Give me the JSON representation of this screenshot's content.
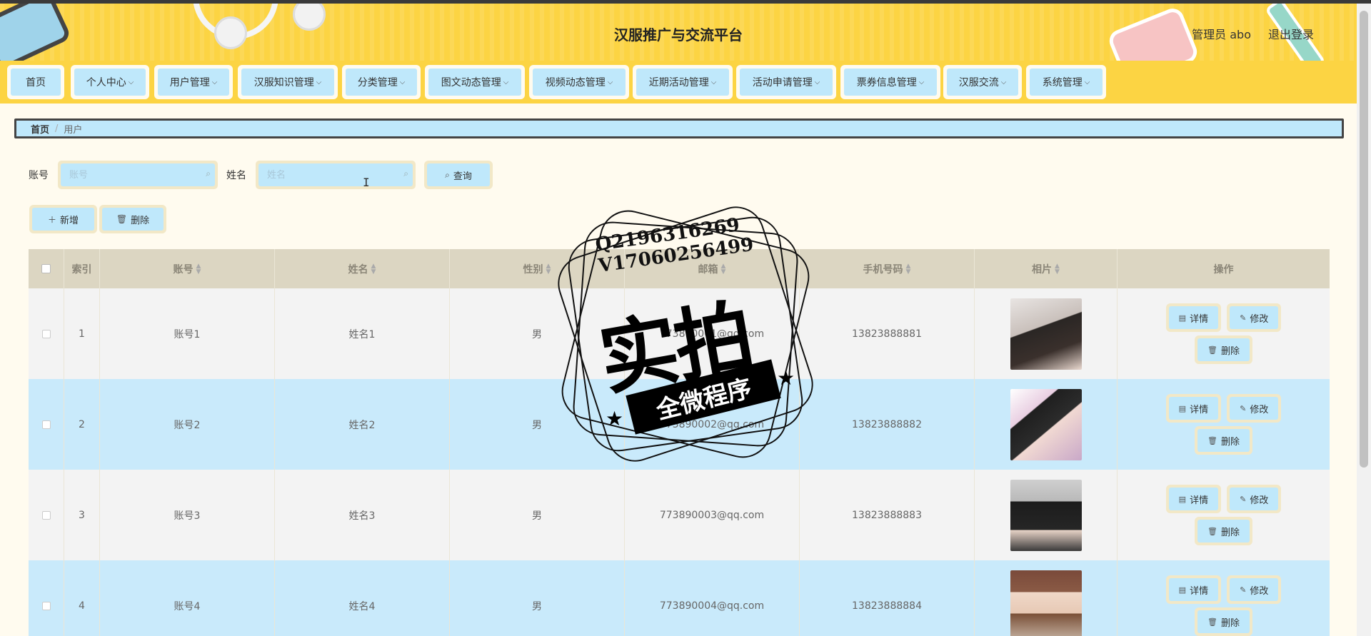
{
  "header": {
    "title": "汉服推广与交流平台",
    "user": "管理员 abo",
    "logout": "退出登录"
  },
  "nav": [
    {
      "label": "首页",
      "dropdown": false
    },
    {
      "label": "个人中心",
      "dropdown": true
    },
    {
      "label": "用户管理",
      "dropdown": true
    },
    {
      "label": "汉服知识管理",
      "dropdown": true
    },
    {
      "label": "分类管理",
      "dropdown": true
    },
    {
      "label": "图文动态管理",
      "dropdown": true
    },
    {
      "label": "视频动态管理",
      "dropdown": true
    },
    {
      "label": "近期活动管理",
      "dropdown": true
    },
    {
      "label": "活动申请管理",
      "dropdown": true
    },
    {
      "label": "票券信息管理",
      "dropdown": true
    },
    {
      "label": "汉服交流",
      "dropdown": true
    },
    {
      "label": "系统管理",
      "dropdown": true
    }
  ],
  "breadcrumb": {
    "home": "首页",
    "sep": "/",
    "current": "用户"
  },
  "search": {
    "account_label": "账号",
    "account_placeholder": "账号",
    "name_label": "姓名",
    "name_placeholder": "姓名",
    "query_button": "查询"
  },
  "toolbar": {
    "add": "新增",
    "delete": "删除"
  },
  "table": {
    "headers": [
      "索引",
      "账号",
      "姓名",
      "性别",
      "邮箱",
      "手机号码",
      "相片",
      "操作"
    ],
    "rows": [
      {
        "index": "1",
        "account": "账号1",
        "name": "姓名1",
        "gender": "男",
        "email": "773890001@qq.com",
        "phone": "13823888881"
      },
      {
        "index": "2",
        "account": "账号2",
        "name": "姓名2",
        "gender": "男",
        "email": "773890002@qq.com",
        "phone": "13823888882"
      },
      {
        "index": "3",
        "account": "账号3",
        "name": "姓名3",
        "gender": "男",
        "email": "773890003@qq.com",
        "phone": "13823888883"
      },
      {
        "index": "4",
        "account": "账号4",
        "name": "姓名4",
        "gender": "男",
        "email": "773890004@qq.com",
        "phone": "13823888884"
      }
    ],
    "actions": {
      "detail": "详情",
      "edit": "修改",
      "delete": "删除"
    }
  },
  "watermark": {
    "line1": "Q2196316269",
    "line2": "V17060256499",
    "big": "实拍",
    "ribbon": "全微程序"
  },
  "colors": {
    "header_bg": "#fcd443",
    "button_bg": "#bfe8fb",
    "button_border": "#f2e8c7",
    "row_alt": "#c9eafb"
  }
}
